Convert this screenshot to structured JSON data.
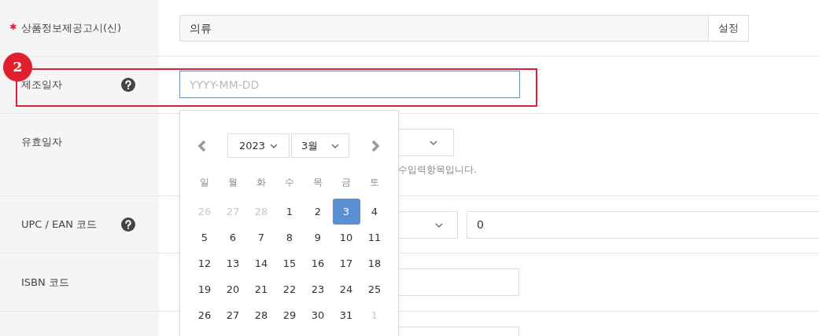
{
  "rows": [
    {
      "label": "상품정보제공고시(신)",
      "required_mark": "✱",
      "help": false,
      "kind": "input_button",
      "value": "의류",
      "button": "설정"
    },
    {
      "label": "제조일자",
      "help": true,
      "kind": "date",
      "placeholder": "YYYY-MM-DD",
      "focused": true,
      "annotation": "2"
    },
    {
      "label": "유효일자",
      "help": false,
      "kind": "select_note",
      "note": "수입력항목입니다."
    },
    {
      "label": "UPC / EAN 코드",
      "help": true,
      "kind": "select_input",
      "value": "0"
    },
    {
      "label": "ISBN 코드",
      "help": false,
      "kind": "input"
    },
    {
      "kind": "input"
    }
  ],
  "calendar": {
    "year": "2023",
    "month": "3월",
    "weekdays": [
      "일",
      "월",
      "화",
      "수",
      "목",
      "금",
      "토"
    ],
    "weeks": [
      [
        {
          "text": "26",
          "muted": true,
          "selected": false
        },
        {
          "text": "27",
          "muted": true,
          "selected": false
        },
        {
          "text": "28",
          "muted": true,
          "selected": false
        },
        {
          "text": "1",
          "muted": false,
          "selected": false
        },
        {
          "text": "2",
          "muted": false,
          "selected": false
        },
        {
          "text": "3",
          "muted": false,
          "selected": true
        },
        {
          "text": "4",
          "muted": false,
          "selected": false
        }
      ],
      [
        {
          "text": "5",
          "muted": false,
          "selected": false
        },
        {
          "text": "6",
          "muted": false,
          "selected": false
        },
        {
          "text": "7",
          "muted": false,
          "selected": false
        },
        {
          "text": "8",
          "muted": false,
          "selected": false
        },
        {
          "text": "9",
          "muted": false,
          "selected": false
        },
        {
          "text": "10",
          "muted": false,
          "selected": false
        },
        {
          "text": "11",
          "muted": false,
          "selected": false
        }
      ],
      [
        {
          "text": "12",
          "muted": false,
          "selected": false
        },
        {
          "text": "13",
          "muted": false,
          "selected": false
        },
        {
          "text": "14",
          "muted": false,
          "selected": false
        },
        {
          "text": "15",
          "muted": false,
          "selected": false
        },
        {
          "text": "16",
          "muted": false,
          "selected": false
        },
        {
          "text": "17",
          "muted": false,
          "selected": false
        },
        {
          "text": "18",
          "muted": false,
          "selected": false
        }
      ],
      [
        {
          "text": "19",
          "muted": false,
          "selected": false
        },
        {
          "text": "20",
          "muted": false,
          "selected": false
        },
        {
          "text": "21",
          "muted": false,
          "selected": false
        },
        {
          "text": "22",
          "muted": false,
          "selected": false
        },
        {
          "text": "23",
          "muted": false,
          "selected": false
        },
        {
          "text": "24",
          "muted": false,
          "selected": false
        },
        {
          "text": "25",
          "muted": false,
          "selected": false
        }
      ],
      [
        {
          "text": "26",
          "muted": false,
          "selected": false
        },
        {
          "text": "27",
          "muted": false,
          "selected": false
        },
        {
          "text": "28",
          "muted": false,
          "selected": false
        },
        {
          "text": "29",
          "muted": false,
          "selected": false
        },
        {
          "text": "30",
          "muted": false,
          "selected": false
        },
        {
          "text": "31",
          "muted": false,
          "selected": false
        },
        {
          "text": "1",
          "muted": true,
          "selected": false
        }
      ]
    ]
  }
}
